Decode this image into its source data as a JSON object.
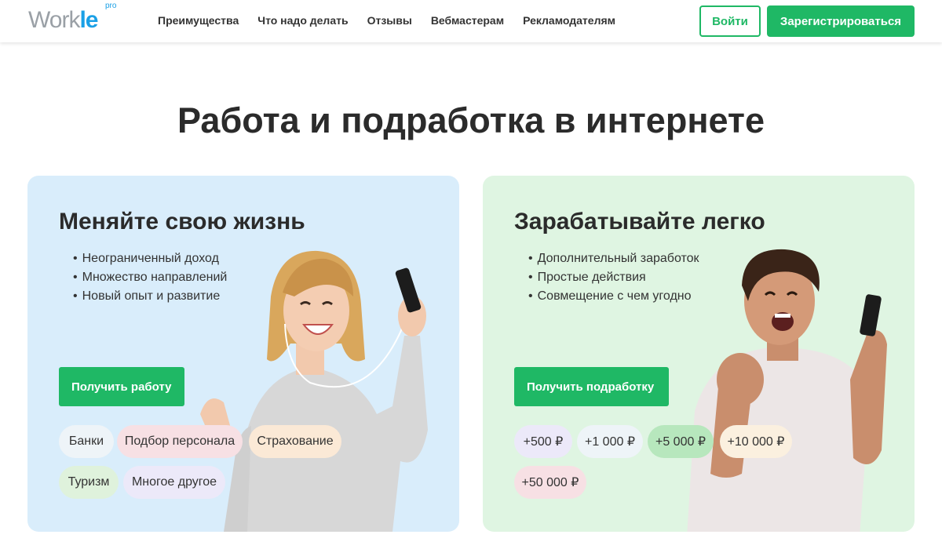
{
  "header": {
    "logo": {
      "word_main": "Work",
      "word_accent": "le",
      "superscript": "pro"
    },
    "nav": [
      "Преимущества",
      "Что надо делать",
      "Отзывы",
      "Вебмастерам",
      "Рекламодателям"
    ],
    "login_label": "Войти",
    "register_label": "Зарегистрироваться"
  },
  "hero": {
    "title": "Работа и подработка в интернете"
  },
  "cards": {
    "left": {
      "title": "Меняйте свою жизнь",
      "bullets": [
        "Неограниченный доход",
        "Множество направлений",
        "Новый опыт и развитие"
      ],
      "cta": "Получить работу",
      "chips": [
        "Банки",
        "Подбор персонала",
        "Страхование",
        "Туризм",
        "Многое другое"
      ]
    },
    "right": {
      "title": "Зарабатывайте легко",
      "bullets": [
        "Дополнительный заработок",
        "Простые действия",
        "Совмещение с чем угодно"
      ],
      "cta": "Получить подработку",
      "chips": [
        "+500 ₽",
        "+1 000 ₽",
        "+5 000 ₽",
        "+10 000 ₽",
        "+50 000 ₽"
      ]
    }
  },
  "colors": {
    "brand_green": "#1fb865",
    "logo_blue": "#1aa0e6",
    "card_left_bg": "#d9edfb",
    "card_right_bg": "#dff5e2"
  }
}
